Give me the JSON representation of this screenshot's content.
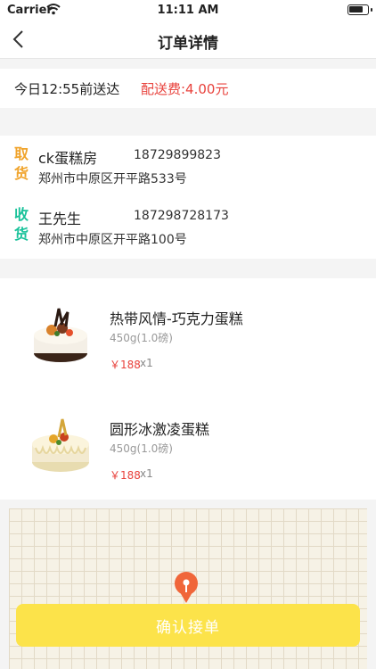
{
  "status_bar": {
    "carrier": "Carrier",
    "time": "11:11 AM"
  },
  "nav": {
    "title": "订单详情"
  },
  "delivery": {
    "time": "今日12:55前送达",
    "fee": "配送费:4.00元"
  },
  "pickup": {
    "badge_top": "取",
    "badge_bottom": "货",
    "name": "ck蛋糕房",
    "phone": "18729899823",
    "address": "郑州市中原区开平路533号"
  },
  "receive": {
    "badge_top": "收",
    "badge_bottom": "货",
    "name": "王先生",
    "phone": "187298728173",
    "address": "郑州市中原区开平路100号"
  },
  "items": [
    {
      "name": "热带风情-巧克力蛋糕",
      "spec": "450g(1.0磅)",
      "price": "￥188",
      "qty": "x1"
    },
    {
      "name": "圆形冰激凌蛋糕",
      "spec": "450g(1.0磅)",
      "price": "￥188",
      "qty": "x1"
    }
  ],
  "confirm_label": "确认接单",
  "colors": {
    "accent_yellow": "#fce34a",
    "price_red": "#e8423c",
    "pickup_orange": "#f0a32a",
    "receive_green": "#19c29a"
  }
}
